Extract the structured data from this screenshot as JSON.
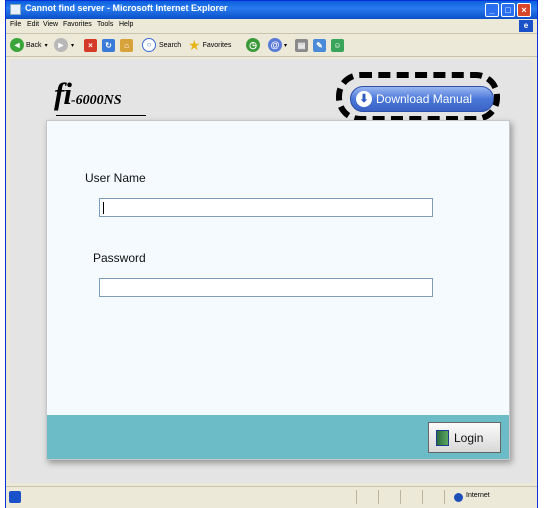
{
  "window": {
    "title": "Cannot find server - Microsoft Internet Explorer"
  },
  "menu": [
    {
      "label": "File"
    },
    {
      "label": "Edit"
    },
    {
      "label": "View"
    },
    {
      "label": "Favorites"
    },
    {
      "label": "Tools"
    },
    {
      "label": "Help"
    }
  ],
  "toolbar": {
    "back_label": "Back",
    "search_label": "Search",
    "favorites_label": "Favorites"
  },
  "page": {
    "logo_main": "fi",
    "logo_model": "-6000NS",
    "download_button": "Download Manual",
    "username_label": "User Name",
    "username_value": "",
    "password_label": "Password",
    "password_value": "",
    "login_button": "Login"
  },
  "status": {
    "zone": "Internet"
  },
  "colors": {
    "accent": "#4a78d8",
    "footer": "#6cbcc8",
    "titlebar": "#0a5fdc"
  }
}
